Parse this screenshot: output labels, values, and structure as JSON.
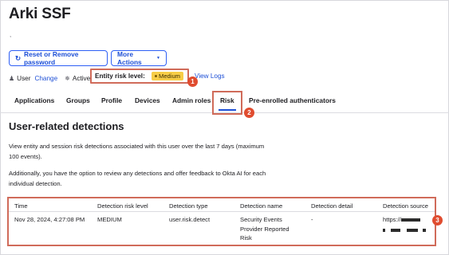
{
  "header": {
    "title": "Arki SSF",
    "subtitle": ","
  },
  "actions": {
    "reset_label": "Reset or Remove password",
    "more_label": "More Actions"
  },
  "status": {
    "user_label": "User",
    "change_link": "Change",
    "active_label": "Active",
    "entity_risk_label": "Entity risk level:",
    "risk_badge": "Medium",
    "view_logs": "View Logs"
  },
  "tabs": [
    {
      "label": "Applications"
    },
    {
      "label": "Groups"
    },
    {
      "label": "Profile"
    },
    {
      "label": "Devices"
    },
    {
      "label": "Admin roles"
    },
    {
      "label": "Risk"
    },
    {
      "label": "Pre-enrolled authenticators"
    }
  ],
  "section": {
    "title": "User-related detections",
    "para1_line1": "View entity and session risk detections associated with this user over the last 7 days (maximum",
    "para1_line2": "100 events).",
    "para2_line1": "Additionally, you have the option to review any detections and offer feedback to Okta AI for each",
    "para2_line2": "individual detection."
  },
  "table": {
    "headers": [
      "Time",
      "Detection risk level",
      "Detection type",
      "Detection name",
      "Detection detail",
      "Detection source"
    ],
    "rows": [
      {
        "time": "Nov 28, 2024, 4:27:08 PM",
        "risk_level": "MEDIUM",
        "type": "user.risk.detect",
        "name_line1": "Security Events",
        "name_line2": "Provider Reported",
        "name_line3": "Risk",
        "detail": "-",
        "source": "https://"
      }
    ]
  },
  "callouts": [
    "1",
    "2",
    "3"
  ],
  "colors": {
    "accent": "#1d4fd6",
    "callout": "#e04c2f",
    "highlight_border": "#d06b5a",
    "badge_medium": "#f7cd47"
  }
}
